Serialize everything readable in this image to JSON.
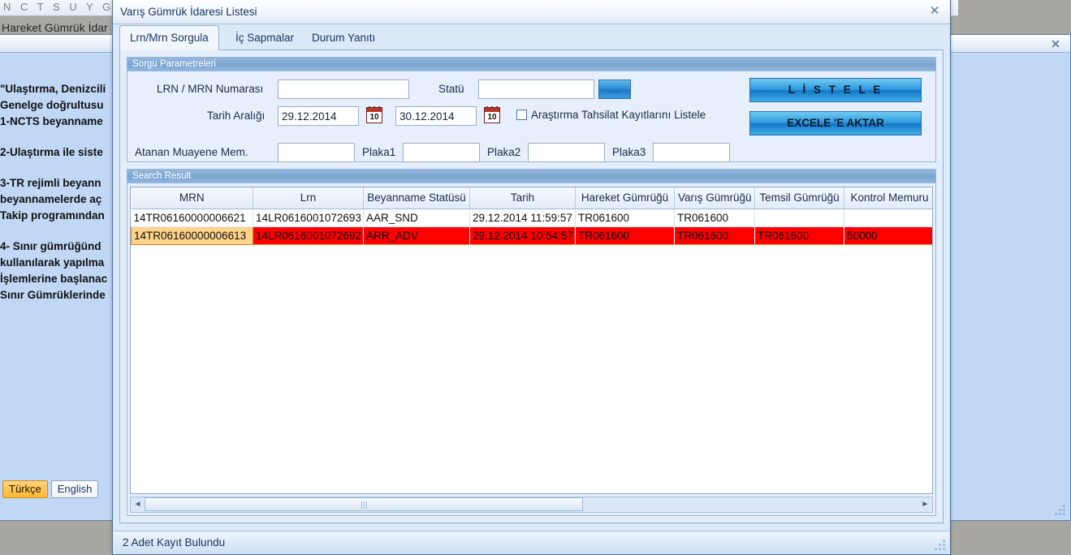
{
  "background": {
    "app_title": "N C T S   U Y G U L A",
    "subheader": "Hareket Gümrük İdar",
    "body_lines": [
      "\"Ulaştırma, Denizcili",
      "Genelge doğrultusu",
      "1-NCTS beyanname",
      "2-Ulaştırma ile siste",
      "3-TR rejimli beyann",
      " beyannamelerde aç",
      "Takip programından",
      " 4- Sınır gümrüğünd",
      " kullanılarak yapılma",
      "İşlemlerine başlanac",
      "Sınır Gümrüklerinde"
    ],
    "lang_tr": "Türkçe",
    "lang_en": "English",
    "close_glyph": "✕"
  },
  "dialog": {
    "title": "Varış Gümrük İdaresi Listesi",
    "close_glyph": "✕",
    "tabs": [
      {
        "label": "Lrn/Mrn Sorgula",
        "active": true
      },
      {
        "label": "İç Sapmalar",
        "active": false
      },
      {
        "label": "Durum Yanıtı",
        "active": false
      }
    ],
    "status_text": "2  Adet Kayıt Bulundu"
  },
  "query": {
    "group_title": "Sorgu Parametreleri",
    "lrn_mrn_label": "LRN / MRN Numarası",
    "lrn_mrn_value": "",
    "lrn_mrn_placeholder": "",
    "statu_label": "Statü",
    "statu_value": "",
    "statu_placeholder": "",
    "dots_button": "...",
    "date_range_label": "Tarih Aralığı",
    "date_from": "29.12.2014",
    "date_to": "30.12.2014",
    "calendar_day": "10",
    "calendar_icon": "calendar-icon",
    "checkbox_label": "Araştırma Tahsilat Kayıtlarını Listele",
    "checkbox_checked": false,
    "officer_label": "Atanan Muayene Mem.",
    "officer_value": "",
    "plaka1_label": "Plaka1",
    "plaka1_value": "",
    "plaka2_label": "Plaka2",
    "plaka2_value": "",
    "plaka3_label": "Plaka3",
    "plaka3_value": "",
    "list_button": "L İ S T E L E",
    "excel_button": "EXCELE 'E AKTAR"
  },
  "results": {
    "group_title": "Search Result",
    "columns": [
      "MRN",
      "Lrn",
      "Beyanname Statüsü",
      "Tarih",
      "Hareket Gümrüğü",
      "Varış Gümrüğü",
      "Temsil Gümrüğü",
      "Kontrol Memuru"
    ],
    "rows": [
      {
        "selected": false,
        "cells": [
          "14TR06160000006621",
          "14LR0616001072693",
          "AAR_SND",
          "29.12.2014 11:59:57",
          "TR061600",
          "TR061600",
          "",
          ""
        ]
      },
      {
        "selected": true,
        "cells": [
          "14TR06160000006613",
          "14LR0616001072692",
          "ARR_ADV",
          "29.12.2014 10:54:57",
          "TR061600",
          "TR061600",
          "TR061600",
          "50000"
        ]
      }
    ],
    "scroll_left_glyph": "◄",
    "scroll_right_glyph": "►"
  },
  "colors": {
    "selected_row": "#ff0000",
    "selected_cell": "#ffd38a",
    "accent_button": "#1f78c4",
    "group_header": "#7ba4d0"
  }
}
